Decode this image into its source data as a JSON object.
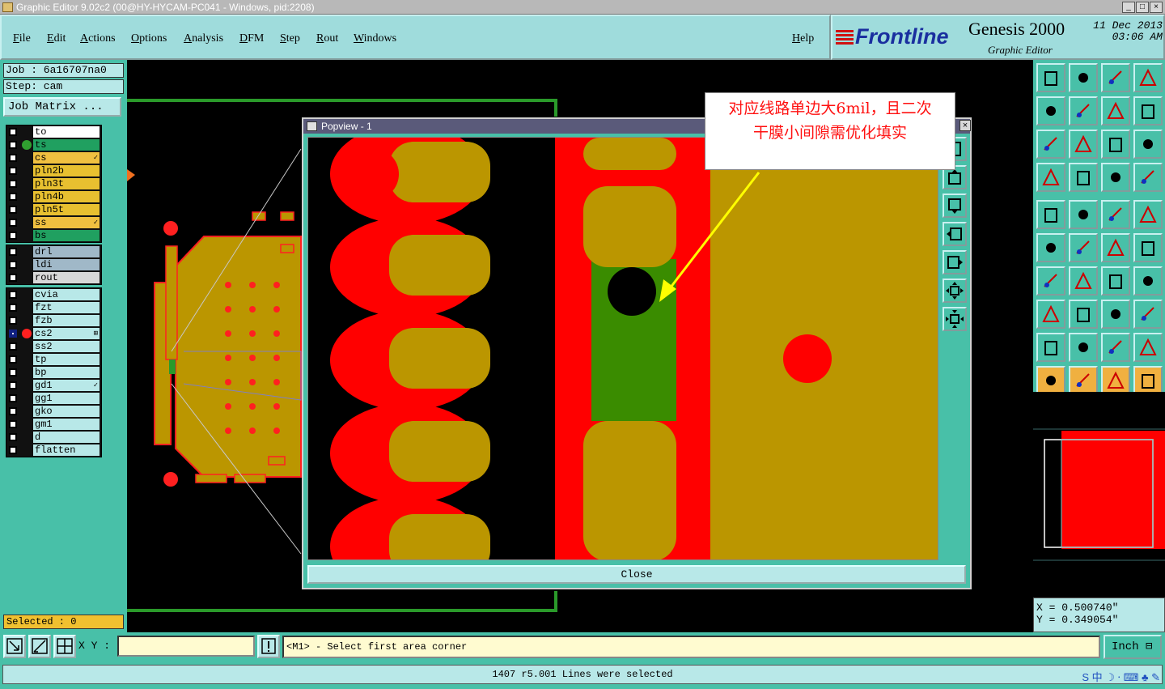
{
  "window": {
    "title": "Graphic Editor 9.02c2 (00@HY-HYCAM-PC041 - Windows, pid:2208)",
    "buttons": [
      "_",
      "□",
      "×"
    ]
  },
  "menubar": {
    "items": [
      "File",
      "Edit",
      "Actions",
      "Options",
      "Analysis",
      "DFM",
      "Step",
      "Rout",
      "Windows"
    ],
    "help": "Help"
  },
  "brand": {
    "logo": "Frontline",
    "product": "Genesis 2000",
    "subtitle": "Graphic Editor",
    "date": "11 Dec 2013",
    "time": "03:06 AM"
  },
  "job": {
    "job_label": "Job : 6a16707na0",
    "step_label": "Step: cam",
    "matrix_button": "Job Matrix ..."
  },
  "layers_group1": [
    {
      "name": "to",
      "color": "#ffffff",
      "dot": ""
    },
    {
      "name": "ts",
      "color": "#20a060",
      "dot": "#30a030"
    },
    {
      "name": "cs",
      "color": "#f0c040",
      "dot": "",
      "mark": "✓"
    },
    {
      "name": "pln2b",
      "color": "#e8c030",
      "dot": ""
    },
    {
      "name": "pln3t",
      "color": "#e8c030",
      "dot": ""
    },
    {
      "name": "pln4b",
      "color": "#e8c030",
      "dot": ""
    },
    {
      "name": "pln5t",
      "color": "#e8c030",
      "dot": ""
    },
    {
      "name": "ss",
      "color": "#f0c040",
      "dot": "",
      "mark": "✓"
    },
    {
      "name": "bs",
      "color": "#20a060",
      "dot": ""
    }
  ],
  "layers_group2": [
    {
      "name": "drl",
      "color": "#a0b8c8",
      "dot": ""
    },
    {
      "name": "ldi",
      "color": "#a0b8c8",
      "dot": ""
    },
    {
      "name": "rout",
      "color": "#d8d8d8",
      "dot": ""
    }
  ],
  "layers_group3": [
    {
      "name": "cvia",
      "color": "#b8e8e8",
      "dot": ""
    },
    {
      "name": "fzt",
      "color": "#b8e8e8",
      "dot": ""
    },
    {
      "name": "fzb",
      "color": "#b8e8e8",
      "dot": ""
    },
    {
      "name": "cs2",
      "color": "#b8e8e8",
      "dot": "#ff2020",
      "mark": "⊞",
      "active": true
    },
    {
      "name": "ss2",
      "color": "#b8e8e8",
      "dot": ""
    },
    {
      "name": "tp",
      "color": "#b8e8e8",
      "dot": ""
    },
    {
      "name": "bp",
      "color": "#b8e8e8",
      "dot": ""
    },
    {
      "name": "gd1",
      "color": "#b8e8e8",
      "dot": "",
      "mark": "✓"
    },
    {
      "name": "gg1",
      "color": "#b8e8e8",
      "dot": ""
    },
    {
      "name": "gko",
      "color": "#b8e8e8",
      "dot": ""
    },
    {
      "name": "gm1",
      "color": "#b8e8e8",
      "dot": ""
    },
    {
      "name": "d",
      "color": "#b8e8e8",
      "dot": ""
    },
    {
      "name": "flatten",
      "color": "#b8e8e8",
      "dot": ""
    }
  ],
  "selected": "Selected : 0",
  "popview": {
    "title": "Popview - 1",
    "close_label": "Close"
  },
  "annotation": {
    "line1": "对应线路单边大6mil，且二次",
    "line2": "干膜小间隙需优化填实"
  },
  "coords": {
    "x": "X = 0.500740\"",
    "y": "Y = 0.349054\""
  },
  "command": {
    "xy_label": "X Y :",
    "xy_value": "",
    "prompt": "<M1> - Select first area corner",
    "units": "Inch"
  },
  "status": "1407 r5.001 Lines were selected",
  "colors": {
    "panel": "#48c0a8",
    "light_panel": "#b8e8e8",
    "copper": "#bb9600",
    "mask": "#ff0000",
    "green_feature": "#3a8c00"
  }
}
